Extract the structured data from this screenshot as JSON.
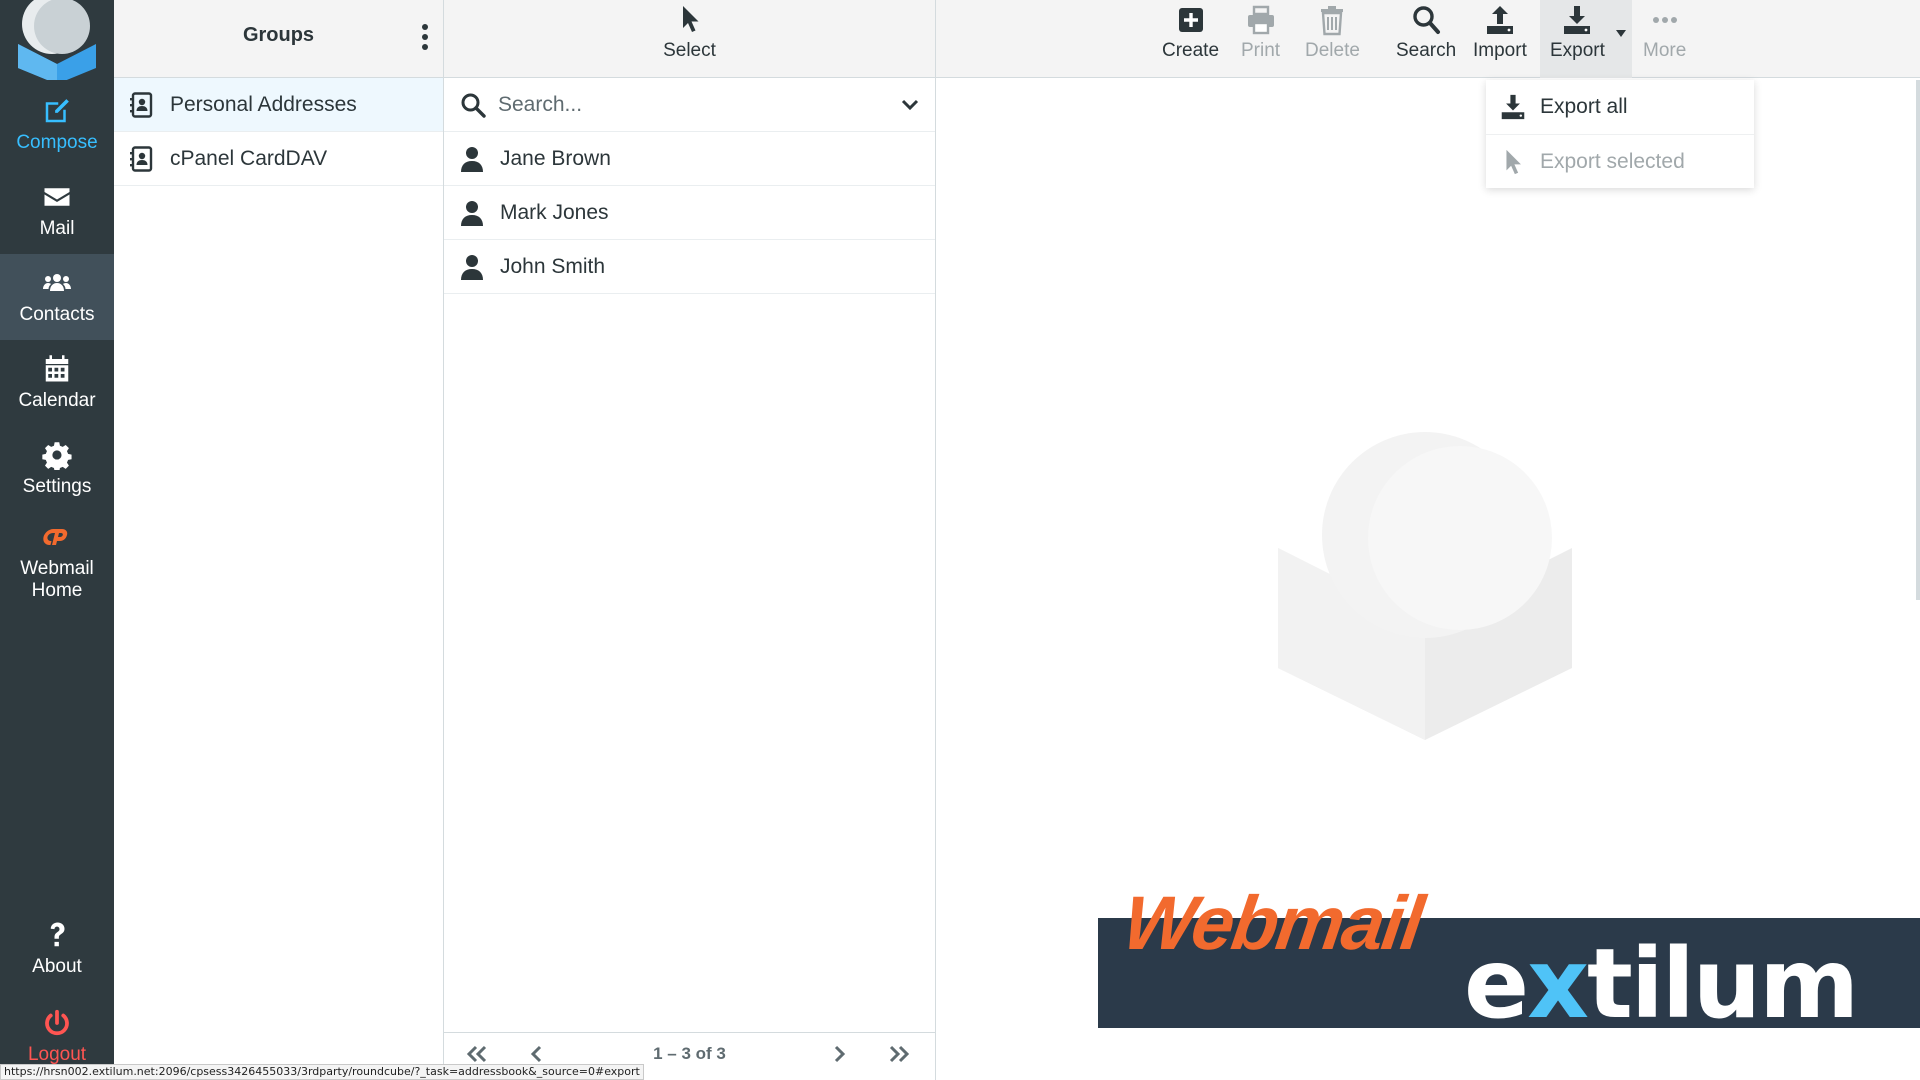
{
  "nav": {
    "compose": "Compose",
    "mail": "Mail",
    "contacts": "Contacts",
    "calendar": "Calendar",
    "settings": "Settings",
    "webmail_home": "Webmail Home",
    "about": "About",
    "logout": "Logout"
  },
  "groups": {
    "title": "Groups",
    "items": [
      {
        "label": "Personal Addresses",
        "selected": true
      },
      {
        "label": "cPanel CardDAV",
        "selected": false
      }
    ]
  },
  "contacts": {
    "select_label": "Select",
    "search_placeholder": "Search...",
    "rows": [
      "Jane Brown",
      "Mark Jones",
      "John Smith"
    ],
    "pager_info": "1 – 3 of 3"
  },
  "toolbar": {
    "create": "Create",
    "print": "Print",
    "delete": "Delete",
    "search": "Search",
    "import": "Import",
    "export": "Export",
    "more": "More"
  },
  "export_menu": {
    "export_all": "Export all",
    "export_selected": "Export selected"
  },
  "branding": {
    "webmail": "Webmail",
    "extilum_e": "e",
    "extilum_x": "x",
    "extilum_rest": "tilum"
  },
  "status_url": "https://hrsn002.extilum.net:2096/cpsess3426455033/3rdparty/roundcube/?_task=addressbook&_source=0#export",
  "colors": {
    "nav_bg": "#2f3a3f",
    "accent": "#37beff",
    "logout": "#ff5552",
    "brand_orange": "#f26a2e"
  }
}
